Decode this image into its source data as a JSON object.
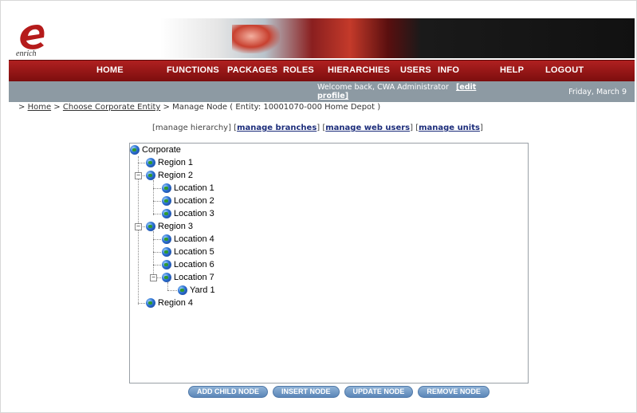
{
  "brand": {
    "logo_text": "enrich"
  },
  "nav": {
    "items": [
      "HOME",
      "FUNCTIONS",
      "PACKAGES",
      "ROLES",
      "HIERARCHIES",
      "USERS",
      "INFO",
      "HELP",
      "LOGOUT"
    ]
  },
  "status": {
    "welcome": "Welcome back,  CWA Administrator",
    "edit_profile": "[edit profile]",
    "date": "Friday, March 9"
  },
  "breadcrumb": {
    "prefix": ">",
    "home": "Home",
    "sep": ">",
    "choose": "Choose Corporate Entity",
    "rest": "> Manage Node  ( Entity: 10001070-000 Home Depot )"
  },
  "tabs": {
    "current": "[manage hierarchy]",
    "branches": "manage branches",
    "web_users": "manage web users",
    "units": "manage units"
  },
  "tree": {
    "corporate": "Corporate",
    "region1": "Region 1",
    "region2": "Region 2",
    "location1": "Location 1",
    "location2": "Location 2",
    "location3": "Location 3",
    "region3": "Region 3",
    "location4": "Location 4",
    "location5": "Location 5",
    "location6": "Location 6",
    "location7": "Location 7",
    "yard1": "Yard 1",
    "region4": "Region 4"
  },
  "buttons": {
    "add_child": "ADD CHILD NODE",
    "insert": "INSERT NODE",
    "update": "UPDATE NODE",
    "remove": "REMOVE NODE"
  },
  "colors": {
    "nav_red": "#9a1616",
    "status_gray": "#8d9aa3",
    "link_blue": "#1b2c7a",
    "button_blue": "#6f98c6"
  }
}
